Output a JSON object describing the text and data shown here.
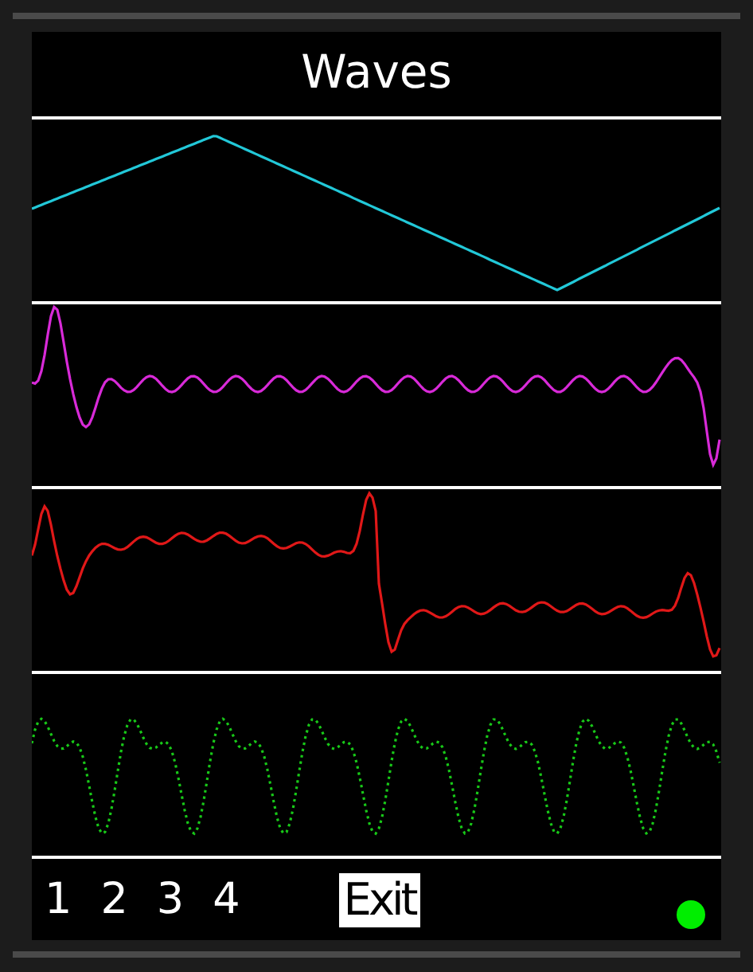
{
  "title": "Waves",
  "waves": [
    {
      "kind": "triangle",
      "color": "#22c8d8",
      "dotted": false
    },
    {
      "kind": "ringing",
      "color": "#d82ad8",
      "dotted": false
    },
    {
      "kind": "ringing-step",
      "color": "#e01818",
      "dotted": false
    },
    {
      "kind": "ripple",
      "color": "#18c818",
      "dotted": true
    }
  ],
  "channel_buttons": [
    "1",
    "2",
    "3",
    "4"
  ],
  "exit_button": "Exit",
  "status_dot": {
    "color": "#00ee00"
  }
}
